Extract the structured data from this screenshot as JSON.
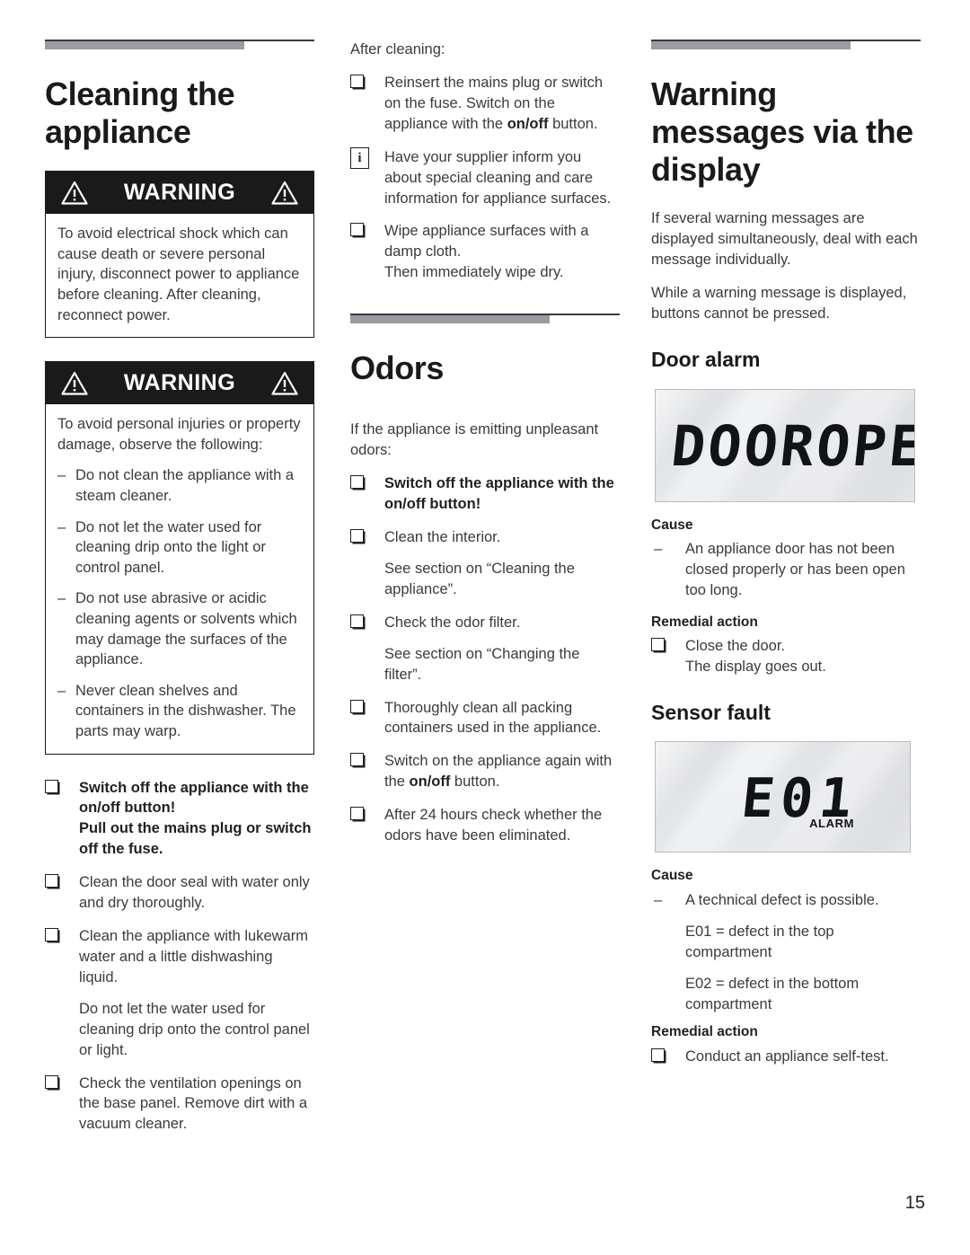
{
  "page": {
    "number": "15"
  },
  "column1": {
    "title": "Cleaning the appliance",
    "warning1": {
      "label": "WARNING",
      "body": "To avoid electrical shock which can cause death or severe personal injury, disconnect power to appliance before cleaning. After cleaning, reconnect power."
    },
    "warning2": {
      "label": "WARNING",
      "intro": "To avoid personal injuries or property damage, observe the following:",
      "items": [
        "Do not clean the appliance with a steam cleaner.",
        "Do not let the water used for cleaning drip onto the light or control panel.",
        "Do not use abrasive or acidic cleaning agents or solvents which may damage the surfaces of the appliance.",
        "Never clean shelves and containers in the dishwasher. The parts may warp."
      ]
    },
    "checklist": [
      {
        "icon": "checkbox",
        "bold": true,
        "text": "Switch off the appliance with the on/off button!",
        "extra": "Pull out the mains plug or switch off the fuse.",
        "extra_bold": true
      },
      {
        "icon": "checkbox",
        "bold": false,
        "text": "Clean the door seal with water only and dry thoroughly."
      },
      {
        "icon": "checkbox",
        "bold": false,
        "text": "Clean the appliance with lukewarm water and a little dishwashing liquid.",
        "extra": "Do not let the water used for cleaning drip onto the control panel or light.",
        "extra_bold": false
      },
      {
        "icon": "checkbox",
        "bold": false,
        "text": "Check the ventilation openings on the base panel. Remove dirt with a vacuum cleaner."
      }
    ]
  },
  "column2": {
    "after_cleaning_label": "After cleaning:",
    "after_cleaning_items": [
      {
        "icon": "checkbox",
        "pre": "Reinsert the mains plug or switch on the fuse. Switch on the appliance with the ",
        "strong": "on/off",
        "post": " button."
      },
      {
        "icon": "info",
        "pre": "Have your supplier inform you about special cleaning and care information for appliance surfaces.",
        "strong": "",
        "post": ""
      },
      {
        "icon": "checkbox",
        "pre": "Wipe appliance surfaces with a damp cloth.",
        "strong": "",
        "post": "",
        "extra": "Then immediately wipe dry."
      }
    ],
    "odors_title": "Odors",
    "odors_intro": "If the appliance is emitting unpleasant odors:",
    "odors_items": [
      {
        "bold": true,
        "text": "Switch off the appliance with the on/off button!"
      },
      {
        "bold": false,
        "text": "Clean the interior.",
        "extra": "See section on “Cleaning the appliance”."
      },
      {
        "bold": false,
        "text": "Check the odor filter.",
        "extra": "See section on “Changing the filter”."
      },
      {
        "bold": false,
        "text": "Thoroughly clean all packing containers used in the appliance."
      },
      {
        "bold": false,
        "pre": "Switch on the appliance again with the ",
        "strong": "on/off",
        "post": " button."
      },
      {
        "bold": false,
        "text": "After 24 hours check whether the odors have been eliminated."
      }
    ]
  },
  "column3": {
    "title": "Warning messages via the display",
    "intro1": "If several warning messages are displayed simultaneously, deal with each message individually.",
    "intro2": "While a warning message is displayed, buttons cannot be pressed.",
    "door_alarm": {
      "heading": "Door alarm",
      "display_text": "DOOROPEN",
      "cause_label": "Cause",
      "cause_text": "An appliance door has not been closed properly or has been open too long.",
      "remedy_label": "Remedial action",
      "remedy_text": "Close the door.",
      "remedy_extra": "The display goes out."
    },
    "sensor_fault": {
      "heading": "Sensor fault",
      "display_text": "E01",
      "display_alarm": "ALARM",
      "cause_label": "Cause",
      "cause_text": "A technical defect is possible.",
      "cause_note1": "E01 = defect in the top compartment",
      "cause_note2": "E02 = defect in the bottom compartment",
      "remedy_label": "Remedial action",
      "remedy_text": "Conduct an appliance self-test."
    }
  },
  "glyphs": {
    "checkbox": "❑",
    "info": "i",
    "dash": "–"
  },
  "colors": {
    "rule_thick": "#9a9ca1",
    "rule_thin": "#3a3a3a",
    "warning_bar": "#1a1a1a",
    "body_text": "#3c3a3b",
    "heading_text": "#1a1a1a"
  }
}
